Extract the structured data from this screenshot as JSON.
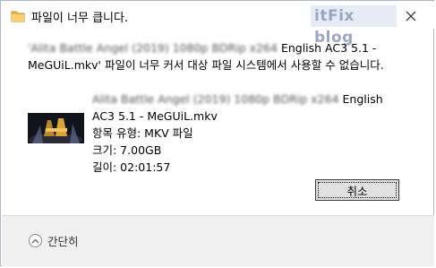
{
  "window": {
    "title": "파일이 너무 큽니다.",
    "watermark": "itFix blog"
  },
  "message": {
    "blurred_prefix": "'Alita Battle Angel (2019) 1080p BDRip x264",
    "visible_rest": " English AC3 5.1 - MeGUiL.mkv' 파일이 너무 커서 대상 파일 시스템에서 사용할 수 없습니다."
  },
  "file": {
    "blurred_prefix": "Alita Battle Angel (2019) 1080p BDRip x264",
    "name_rest": " English AC3 5.1 - MeGUiL.mkv",
    "type_line": "항목 유형: MKV 파일",
    "size_line": "크기: 7.00GB",
    "length_line": "길이: 02:01:57"
  },
  "buttons": {
    "cancel": "취소"
  },
  "footer": {
    "collapse_label": "간단히"
  },
  "icons": {
    "title": "folder-icon",
    "close": "close-icon",
    "collapse": "chevron-up-icon"
  }
}
